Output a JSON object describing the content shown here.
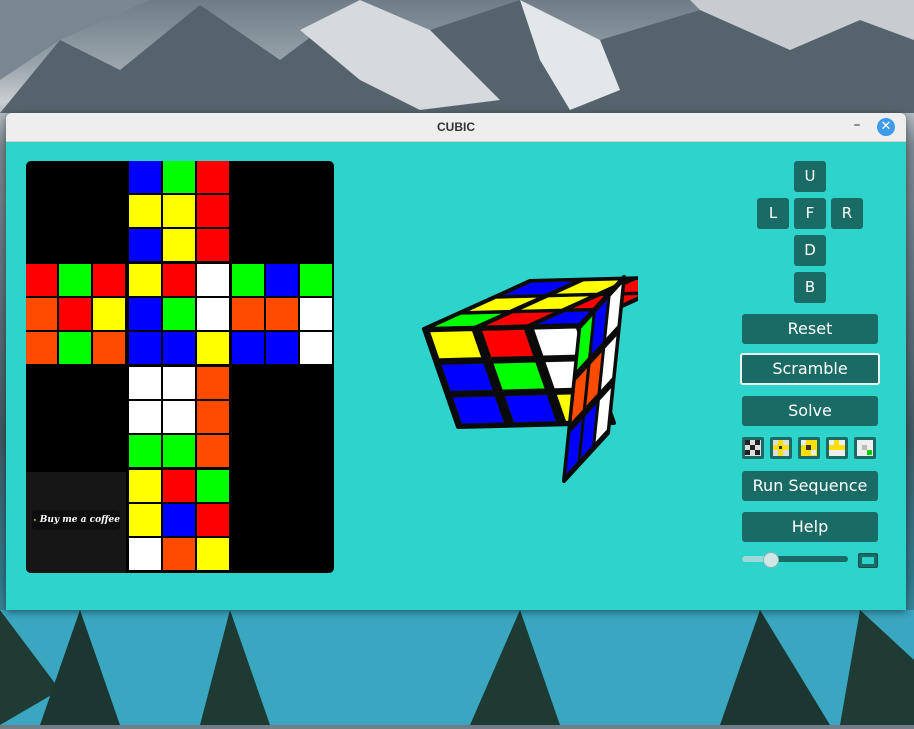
{
  "window": {
    "title": "CUBIC"
  },
  "controls": {
    "faces": [
      "U",
      "L",
      "F",
      "R",
      "D",
      "B"
    ],
    "reset_label": "Reset",
    "scramble_label": "Scramble",
    "solve_label": "Solve",
    "run_sequence_label": "Run Sequence",
    "help_label": "Help",
    "speed": 0.2
  },
  "coffee": {
    "label": "Buy me a coffee"
  },
  "colors": {
    "B": "#0000ff",
    "G": "#00ff00",
    "R": "#ff0000",
    "Y": "#ffff00",
    "O": "#ff4b00",
    "W": "#ffffff",
    "bg": "#2ed3cb",
    "button": "#1a6b66"
  },
  "net": {
    "U": [
      "BGR",
      "YYR",
      "BYR"
    ],
    "L": [
      "RGR",
      "ORY",
      "OGO"
    ],
    "F": [
      "YRW",
      "BGW",
      "BBY"
    ],
    "R": [
      "GBG",
      "OOW",
      "BBW"
    ],
    "D": [
      "WWO",
      "WWO",
      "GGO"
    ],
    "B": [
      "YRG",
      "YBR",
      "WOY"
    ]
  }
}
